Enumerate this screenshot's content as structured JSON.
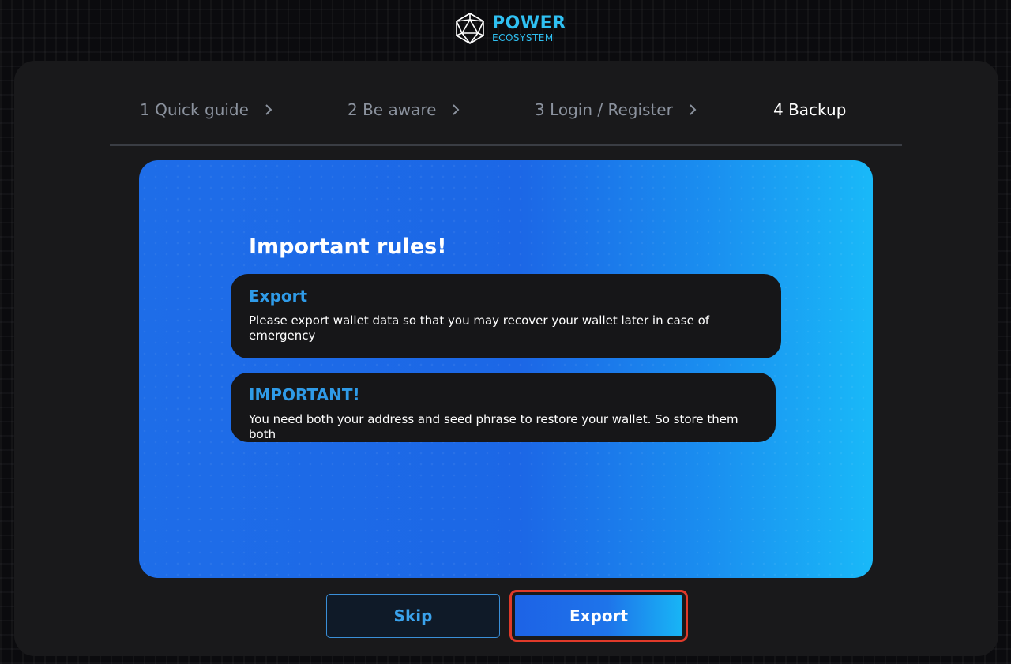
{
  "logo": {
    "line1": "POWER",
    "line2": "ECOSYSTEM",
    "icon": "icosahedron-logo-icon"
  },
  "steps": [
    {
      "label": "1 Quick guide",
      "active": false
    },
    {
      "label": "2 Be aware",
      "active": false
    },
    {
      "label": "3 Login / Register",
      "active": false
    },
    {
      "label": "4 Backup",
      "active": true
    }
  ],
  "card": {
    "title": "Important rules!",
    "rules": [
      {
        "title": "Export",
        "text": "Please export wallet data so that you may recover your wallet later in case of emergency"
      },
      {
        "title": "IMPORTANT!",
        "text": "You need both your address and seed phrase to restore your wallet. So store them both"
      }
    ]
  },
  "buttons": {
    "skip": "Skip",
    "export": "Export"
  },
  "colors": {
    "accent": "#2fc0f2",
    "panel": "#19191b",
    "card_start": "#1e6de8",
    "card_end": "#19b9f8",
    "highlight": "#e03a2a"
  }
}
